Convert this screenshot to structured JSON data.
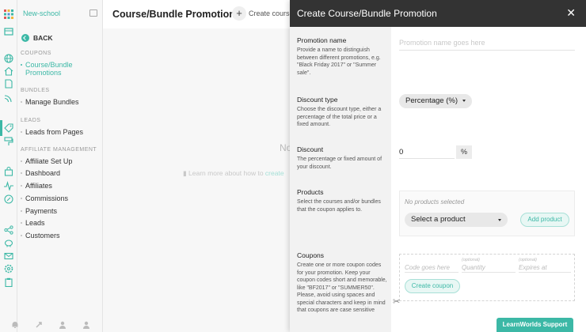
{
  "app": {
    "brand": "New-school"
  },
  "nav": {
    "back_label": "BACK",
    "sections": [
      {
        "title": "COUPONS",
        "items": [
          {
            "label": "Course/Bundle Promotions",
            "active": true
          }
        ]
      },
      {
        "title": "BUNDLES",
        "items": [
          {
            "label": "Manage Bundles"
          }
        ]
      },
      {
        "title": "LEADS",
        "items": [
          {
            "label": "Leads from Pages"
          }
        ]
      },
      {
        "title": "AFFILIATE MANAGEMENT",
        "items": [
          {
            "label": "Affiliate Set Up"
          },
          {
            "label": "Dashboard"
          },
          {
            "label": "Affiliates"
          },
          {
            "label": "Commissions"
          },
          {
            "label": "Payments"
          },
          {
            "label": "Leads"
          },
          {
            "label": "Customers"
          }
        ]
      }
    ]
  },
  "page": {
    "title": "Course/Bundle Promotions",
    "create_label": "Create course",
    "empty_text": "No",
    "learn_text": "Learn more about how to ",
    "learn_link": "create"
  },
  "modal": {
    "title": "Create Course/Bundle Promotion",
    "fields": {
      "promotion_name": {
        "label": "Promotion name",
        "description": "Provide a name to distinguish between different promotions, e.g. \"Black Friday 2017\" or \"Summer sale\".",
        "placeholder": "Promotion name goes here"
      },
      "discount_type": {
        "label": "Discount type",
        "description": "Choose the discount type, either a percentage of the total price or a fixed amount.",
        "value": "Percentage (%)"
      },
      "discount": {
        "label": "Discount",
        "description": "The percentage or fixed amount of your discount.",
        "value": "0",
        "unit": "%"
      },
      "products": {
        "label": "Products",
        "description": "Select the courses and/or bundles that the coupon applies to.",
        "empty": "No products selected",
        "select_label": "Select a product",
        "add_label": "Add product"
      },
      "coupons": {
        "label": "Coupons",
        "description": "Create one or more coupon codes for your promotion. Keep your coupon codes short and memorable, like \"BF2017\" or \"SUMMER50\". Please, avoid using spaces and special characters and keep in mind that coupons are case sensitive",
        "code_placeholder": "Code goes here",
        "quantity_optional": "(optional)",
        "quantity_placeholder": "Quantity",
        "expires_optional": "(optional)",
        "expires_placeholder": "Expires at",
        "create_label": "Create coupon"
      }
    }
  },
  "support": {
    "label": "LearnWorlds Support"
  },
  "colors": {
    "accent": "#3cb8a6",
    "header": "#333333"
  },
  "icons": [
    "apps-icon",
    "collapse-icon",
    "book-icon",
    "globe-icon",
    "home-icon",
    "page-icon",
    "rss-icon",
    "tag-icon",
    "paint-roller-icon",
    "bag-icon",
    "pulse-icon",
    "percent-icon",
    "share-icon",
    "piggy-bank-icon",
    "mail-icon",
    "gear-icon",
    "clipboard-icon",
    "bell-icon",
    "rocket-icon",
    "user-icon",
    "user-gear-icon",
    "close-icon",
    "scissors-icon"
  ]
}
